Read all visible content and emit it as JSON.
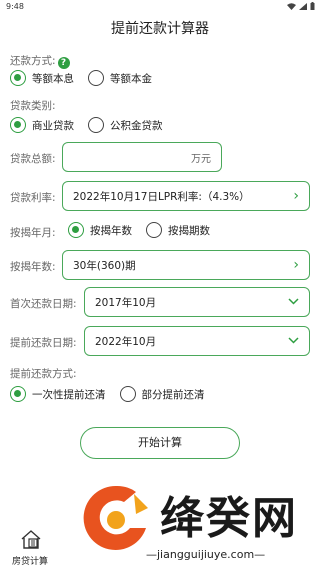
{
  "status": {
    "time": "9:48"
  },
  "title": "提前还款计算器",
  "repayment_method": {
    "label": "还款方式:",
    "options": [
      "等额本息",
      "等额本金"
    ],
    "selected": 0
  },
  "loan_type": {
    "label": "贷款类别:",
    "options": [
      "商业贷款",
      "公积金贷款"
    ],
    "selected": 0
  },
  "loan_amount": {
    "label": "贷款总额:",
    "value": "",
    "unit": "万元"
  },
  "loan_rate": {
    "label": "贷款利率:",
    "value": "2022年10月17日LPR利率:（4.3%）"
  },
  "mortgage_by": {
    "label": "按揭年月:",
    "options": [
      "按揭年数",
      "按揭期数"
    ],
    "selected": 0
  },
  "mortgage_years": {
    "label": "按揭年数:",
    "value": "30年(360)期"
  },
  "first_repay_date": {
    "label": "首次还款日期:",
    "value": "2017年10月"
  },
  "prepay_date": {
    "label": "提前还款日期:",
    "value": "2022年10月"
  },
  "prepay_method": {
    "label": "提前还款方式:",
    "options": [
      "一次性提前还清",
      "部分提前还清"
    ],
    "selected": 0
  },
  "calc_button": "开始计算",
  "watermark": {
    "name": "绛癸网",
    "url": "—jiangguijiuye.com—"
  },
  "bottom_nav": {
    "label": "房贷计算"
  },
  "colors": {
    "accent": "#2e9e41",
    "border": "#4aa85a"
  }
}
